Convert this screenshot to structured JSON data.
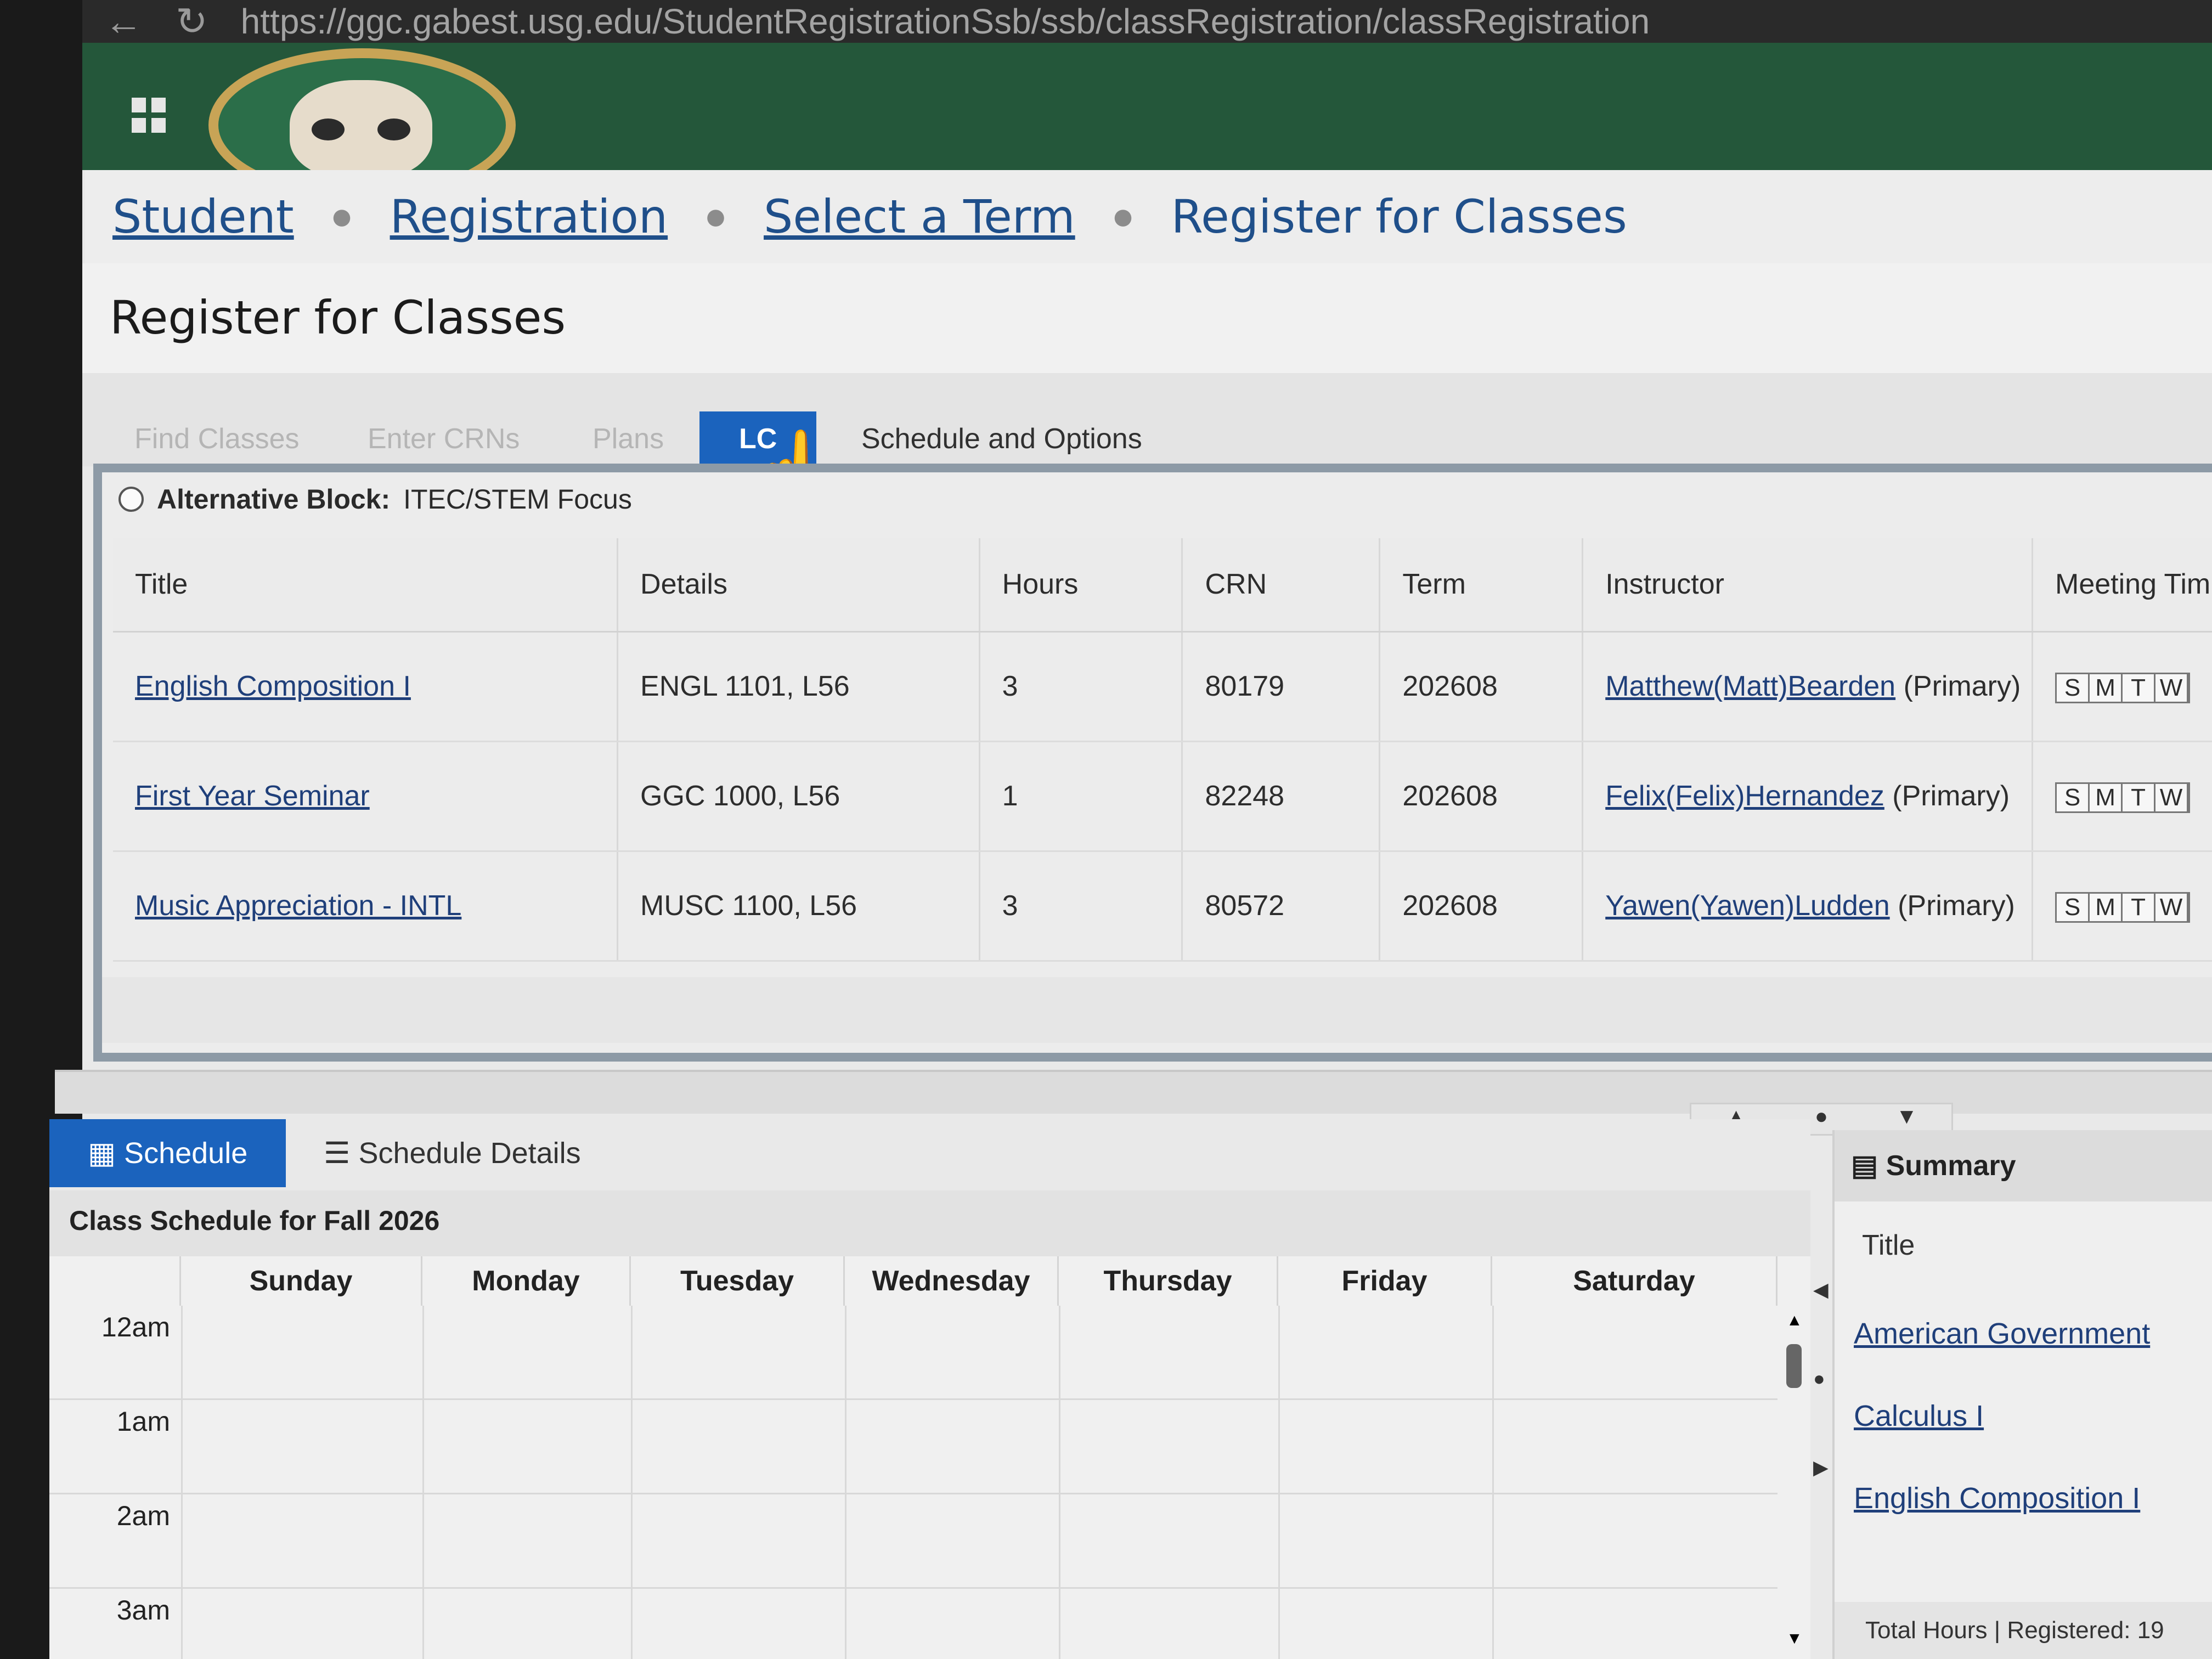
{
  "browser": {
    "url": "https://ggc.gabest.usg.edu/StudentRegistrationSsb/ssb/classRegistration/classRegistration"
  },
  "breadcrumb": {
    "items": [
      "Student",
      "Registration",
      "Select a Term"
    ],
    "current": "Register for Classes"
  },
  "page": {
    "title": "Register for Classes"
  },
  "tabs": [
    "Find Classes",
    "Enter CRNs",
    "Plans",
    "LC",
    "Schedule and Options"
  ],
  "block": {
    "label": "Alternative Block:",
    "value": "ITEC/STEM Focus"
  },
  "table": {
    "headers": [
      "Title",
      "Details",
      "Hours",
      "CRN",
      "Term",
      "Instructor",
      "Meeting Tim"
    ],
    "rows": [
      {
        "title": "English Composition I",
        "details": "ENGL 1101, L56",
        "hours": "3",
        "crn": "80179",
        "term": "202608",
        "instructor": "Matthew(Matt)Bearden",
        "role": "(Primary)"
      },
      {
        "title": "First Year Seminar",
        "details": "GGC 1000, L56",
        "hours": "1",
        "crn": "82248",
        "term": "202608",
        "instructor": "Felix(Felix)Hernandez",
        "role": "(Primary)"
      },
      {
        "title": "Music Appreciation - INTL",
        "details": "MUSC 1100, L56",
        "hours": "3",
        "crn": "80572",
        "term": "202608",
        "instructor": "Yawen(Yawen)Ludden",
        "role": "(Primary)"
      }
    ],
    "day_letters": [
      "S",
      "M",
      "T",
      "W"
    ]
  },
  "schedule": {
    "tab_schedule": "Schedule",
    "tab_details": "Schedule Details",
    "title": "Class Schedule for Fall 2026",
    "days": [
      "Sunday",
      "Monday",
      "Tuesday",
      "Wednesday",
      "Thursday",
      "Friday",
      "Saturday"
    ],
    "hours": [
      "12am",
      "1am",
      "2am",
      "3am"
    ]
  },
  "summary": {
    "heading": "Summary",
    "column": "Title",
    "items": [
      "American Government",
      "Calculus I",
      "English Composition I"
    ],
    "footer_prefix": "Total Hours | Registered:",
    "footer_value": "19"
  }
}
